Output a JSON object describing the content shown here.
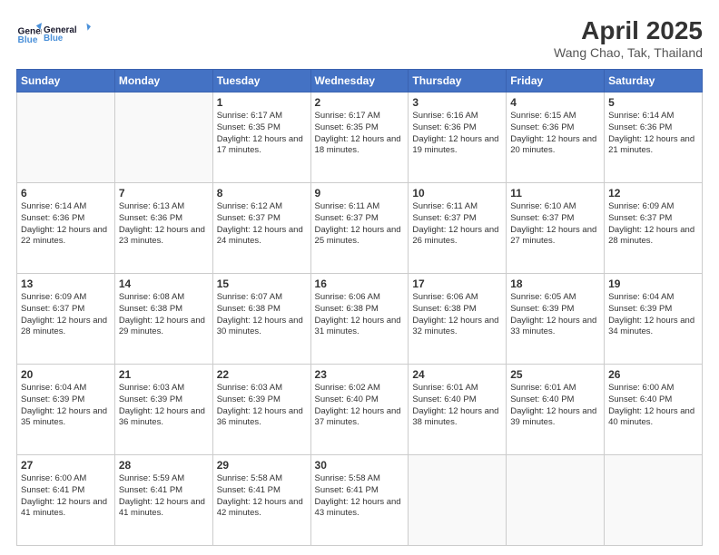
{
  "header": {
    "logo_line1": "General",
    "logo_line2": "Blue",
    "title": "April 2025",
    "subtitle": "Wang Chao, Tak, Thailand"
  },
  "weekdays": [
    "Sunday",
    "Monday",
    "Tuesday",
    "Wednesday",
    "Thursday",
    "Friday",
    "Saturday"
  ],
  "weeks": [
    [
      {
        "day": "",
        "info": ""
      },
      {
        "day": "",
        "info": ""
      },
      {
        "day": "1",
        "info": "Sunrise: 6:17 AM\nSunset: 6:35 PM\nDaylight: 12 hours and 17 minutes."
      },
      {
        "day": "2",
        "info": "Sunrise: 6:17 AM\nSunset: 6:35 PM\nDaylight: 12 hours and 18 minutes."
      },
      {
        "day": "3",
        "info": "Sunrise: 6:16 AM\nSunset: 6:36 PM\nDaylight: 12 hours and 19 minutes."
      },
      {
        "day": "4",
        "info": "Sunrise: 6:15 AM\nSunset: 6:36 PM\nDaylight: 12 hours and 20 minutes."
      },
      {
        "day": "5",
        "info": "Sunrise: 6:14 AM\nSunset: 6:36 PM\nDaylight: 12 hours and 21 minutes."
      }
    ],
    [
      {
        "day": "6",
        "info": "Sunrise: 6:14 AM\nSunset: 6:36 PM\nDaylight: 12 hours and 22 minutes."
      },
      {
        "day": "7",
        "info": "Sunrise: 6:13 AM\nSunset: 6:36 PM\nDaylight: 12 hours and 23 minutes."
      },
      {
        "day": "8",
        "info": "Sunrise: 6:12 AM\nSunset: 6:37 PM\nDaylight: 12 hours and 24 minutes."
      },
      {
        "day": "9",
        "info": "Sunrise: 6:11 AM\nSunset: 6:37 PM\nDaylight: 12 hours and 25 minutes."
      },
      {
        "day": "10",
        "info": "Sunrise: 6:11 AM\nSunset: 6:37 PM\nDaylight: 12 hours and 26 minutes."
      },
      {
        "day": "11",
        "info": "Sunrise: 6:10 AM\nSunset: 6:37 PM\nDaylight: 12 hours and 27 minutes."
      },
      {
        "day": "12",
        "info": "Sunrise: 6:09 AM\nSunset: 6:37 PM\nDaylight: 12 hours and 28 minutes."
      }
    ],
    [
      {
        "day": "13",
        "info": "Sunrise: 6:09 AM\nSunset: 6:37 PM\nDaylight: 12 hours and 28 minutes."
      },
      {
        "day": "14",
        "info": "Sunrise: 6:08 AM\nSunset: 6:38 PM\nDaylight: 12 hours and 29 minutes."
      },
      {
        "day": "15",
        "info": "Sunrise: 6:07 AM\nSunset: 6:38 PM\nDaylight: 12 hours and 30 minutes."
      },
      {
        "day": "16",
        "info": "Sunrise: 6:06 AM\nSunset: 6:38 PM\nDaylight: 12 hours and 31 minutes."
      },
      {
        "day": "17",
        "info": "Sunrise: 6:06 AM\nSunset: 6:38 PM\nDaylight: 12 hours and 32 minutes."
      },
      {
        "day": "18",
        "info": "Sunrise: 6:05 AM\nSunset: 6:39 PM\nDaylight: 12 hours and 33 minutes."
      },
      {
        "day": "19",
        "info": "Sunrise: 6:04 AM\nSunset: 6:39 PM\nDaylight: 12 hours and 34 minutes."
      }
    ],
    [
      {
        "day": "20",
        "info": "Sunrise: 6:04 AM\nSunset: 6:39 PM\nDaylight: 12 hours and 35 minutes."
      },
      {
        "day": "21",
        "info": "Sunrise: 6:03 AM\nSunset: 6:39 PM\nDaylight: 12 hours and 36 minutes."
      },
      {
        "day": "22",
        "info": "Sunrise: 6:03 AM\nSunset: 6:39 PM\nDaylight: 12 hours and 36 minutes."
      },
      {
        "day": "23",
        "info": "Sunrise: 6:02 AM\nSunset: 6:40 PM\nDaylight: 12 hours and 37 minutes."
      },
      {
        "day": "24",
        "info": "Sunrise: 6:01 AM\nSunset: 6:40 PM\nDaylight: 12 hours and 38 minutes."
      },
      {
        "day": "25",
        "info": "Sunrise: 6:01 AM\nSunset: 6:40 PM\nDaylight: 12 hours and 39 minutes."
      },
      {
        "day": "26",
        "info": "Sunrise: 6:00 AM\nSunset: 6:40 PM\nDaylight: 12 hours and 40 minutes."
      }
    ],
    [
      {
        "day": "27",
        "info": "Sunrise: 6:00 AM\nSunset: 6:41 PM\nDaylight: 12 hours and 41 minutes."
      },
      {
        "day": "28",
        "info": "Sunrise: 5:59 AM\nSunset: 6:41 PM\nDaylight: 12 hours and 41 minutes."
      },
      {
        "day": "29",
        "info": "Sunrise: 5:58 AM\nSunset: 6:41 PM\nDaylight: 12 hours and 42 minutes."
      },
      {
        "day": "30",
        "info": "Sunrise: 5:58 AM\nSunset: 6:41 PM\nDaylight: 12 hours and 43 minutes."
      },
      {
        "day": "",
        "info": ""
      },
      {
        "day": "",
        "info": ""
      },
      {
        "day": "",
        "info": ""
      }
    ]
  ]
}
